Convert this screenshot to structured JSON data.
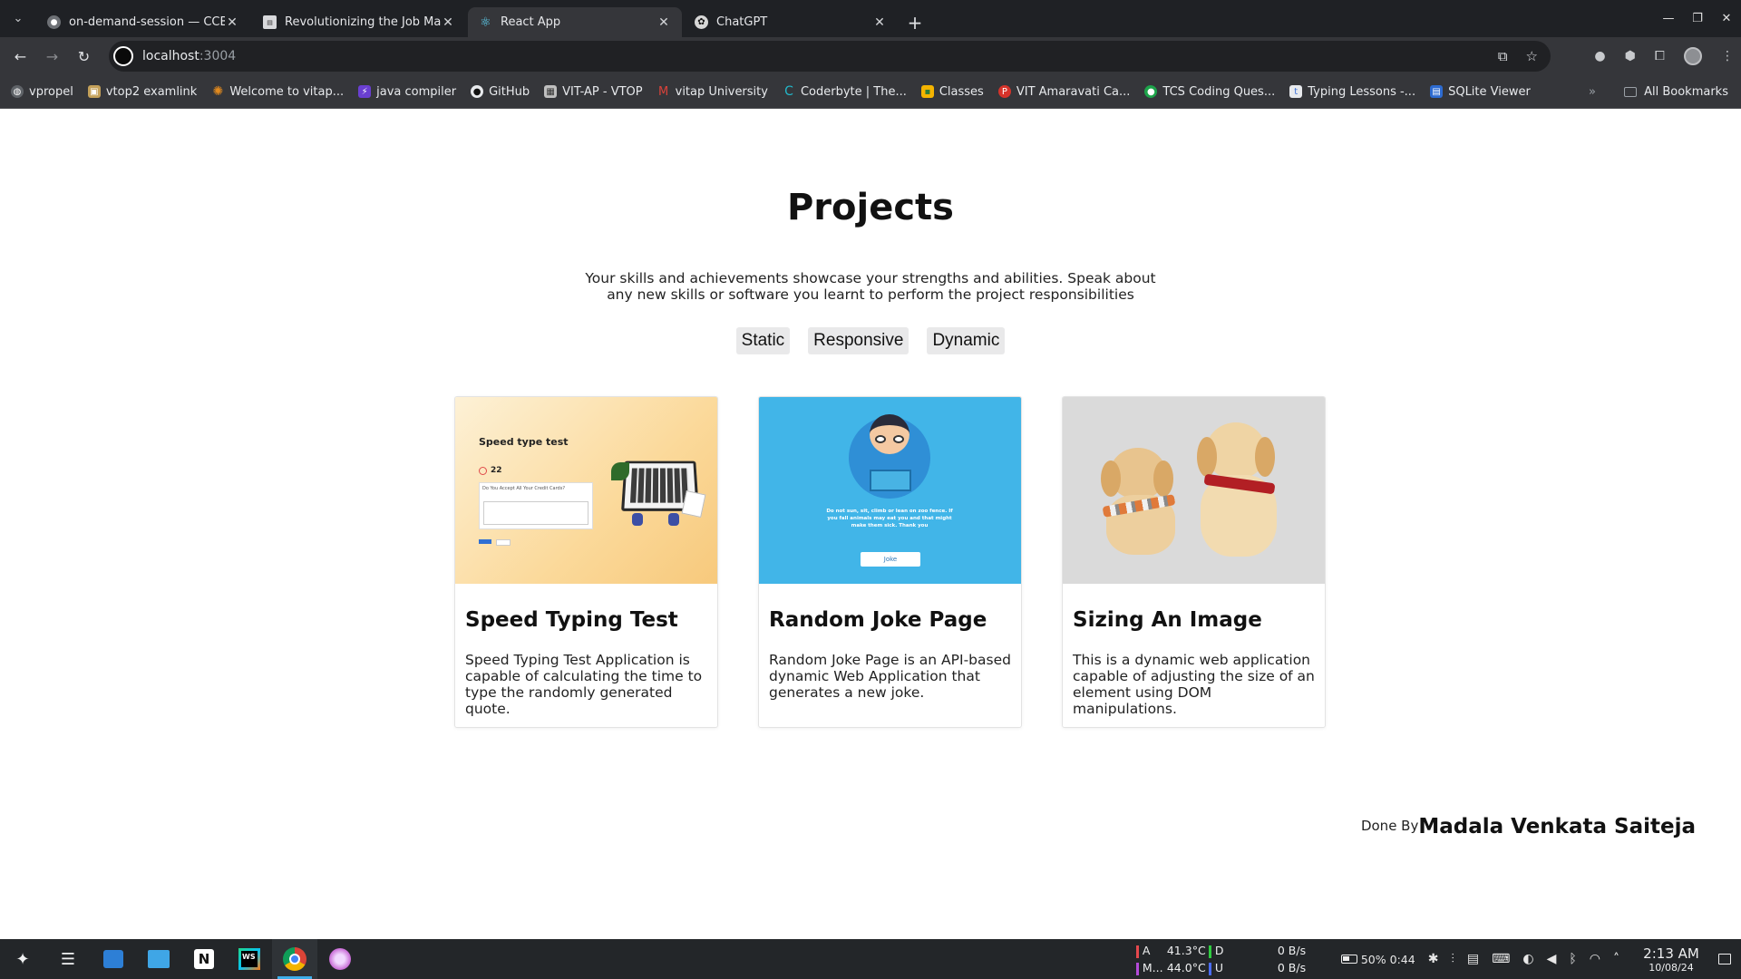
{
  "browser": {
    "tabs": [
      {
        "label": "on-demand-session — CCB",
        "icon": "globe-icon",
        "active": false
      },
      {
        "label": "Revolutionizing the Job Mar",
        "icon": "document-icon",
        "active": false
      },
      {
        "label": "React App",
        "icon": "react-icon",
        "active": true
      },
      {
        "label": "ChatGPT",
        "icon": "chatgpt-icon",
        "active": false
      }
    ],
    "url_host": "localhost",
    "url_port": ":3004",
    "bookmarks": [
      {
        "label": "vpropel",
        "icon": "globe-icon",
        "color": "#9aa0a6"
      },
      {
        "label": "vtop2 examlink",
        "icon": "image-icon",
        "color": "#c4a15a"
      },
      {
        "label": "Welcome to vitap...",
        "icon": "flower-icon",
        "color": "#e28a1e"
      },
      {
        "label": "java compiler",
        "icon": "bolt-icon",
        "color": "#6a3fd1"
      },
      {
        "label": "GitHub",
        "icon": "github-icon",
        "color": "#e8eaed"
      },
      {
        "label": "VIT-AP - VTOP",
        "icon": "page-icon",
        "color": "#bfbfbf"
      },
      {
        "label": "vitap University",
        "icon": "gmail-icon",
        "color": "#d9423a"
      },
      {
        "label": "Coderbyte | The...",
        "icon": "coderbyte-icon",
        "color": "#23b7c9"
      },
      {
        "label": "Classes",
        "icon": "classroom-icon",
        "color": "#f4b400"
      },
      {
        "label": "VIT Amaravati Ca...",
        "icon": "pinterest-icon",
        "color": "#d6332a"
      },
      {
        "label": "TCS Coding Ques...",
        "icon": "tcs-icon",
        "color": "#1da34a"
      },
      {
        "label": "Typing Lessons -...",
        "icon": "typing-icon",
        "color": "#3b6fd8"
      },
      {
        "label": "SQLite Viewer",
        "icon": "sqlite-icon",
        "color": "#2d6bd1"
      }
    ],
    "all_bookmarks": "All Bookmarks",
    "more": "»"
  },
  "page": {
    "title": "Projects",
    "subtitle": "Your skills and achievements showcase your strengths and abilities. Speak about any new skills or software you learnt to perform the project responsibilities",
    "filters": [
      "Static",
      "Responsive",
      "Dynamic"
    ],
    "cards": [
      {
        "title": "Speed Typing Test",
        "description": "Speed Typing Test Application is capable of calculating the time to type the randomly generated quote.",
        "thumb": {
          "heading": "Speed type test",
          "timer": "22",
          "input_hint": "Do You Accept All Your Credit Cards?"
        }
      },
      {
        "title": "Random Joke Page",
        "description": "Random Joke Page is an API-based dynamic Web Application that generates a new joke.",
        "thumb": {
          "joke_text": "Do not sun, sit, climb or lean on zoo fence. If you fall animals may eat you and that might make them sick. Thank you",
          "button": "Joke"
        }
      },
      {
        "title": "Sizing An Image",
        "description": "This is a dynamic web application capable of adjusting the size of an element using DOM manipulations.",
        "thumb": {}
      }
    ],
    "footer": {
      "done_by": "Done By",
      "author": "Madala Venkata Saiteja"
    }
  },
  "taskbar": {
    "monitor": {
      "a_label": "A",
      "a_temp": "41.3°C",
      "m_label": "M...",
      "m_temp": "44.0°C",
      "d_label": "D",
      "u_label": "U",
      "down": "0 B/s",
      "up": "0 B/s"
    },
    "battery": "50% 0:44",
    "time": "2:13 AM",
    "date": "10/08/24"
  }
}
